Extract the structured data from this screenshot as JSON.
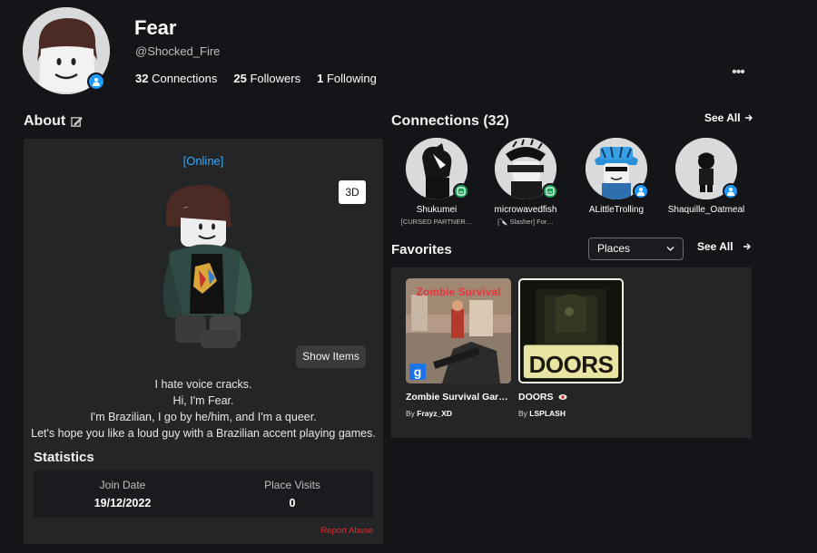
{
  "profile": {
    "display_name": "Fear",
    "username": "@Shocked_Fire",
    "connections_count": "32",
    "connections_label": "Connections",
    "followers_count": "25",
    "followers_label": "Followers",
    "following_count": "1",
    "following_label": "Following",
    "more_label": "•••"
  },
  "about": {
    "title": "About",
    "status": "[Online]",
    "view_3d_label": "3D",
    "show_items_label": "Show Items",
    "bio_lines": [
      "I hate voice cracks.",
      "Hi, I'm Fear.",
      "I'm Brazilian, I go by he/him, and I'm a queer.",
      "Let's hope you like a loud guy with a Brazilian accent playing games."
    ]
  },
  "statistics": {
    "title": "Statistics",
    "join_date_label": "Join Date",
    "join_date_value": "19/12/2022",
    "place_visits_label": "Place Visits",
    "place_visits_value": "0",
    "report_label": "Report Abuse"
  },
  "connections": {
    "title": "Connections (32)",
    "see_all_label": "See All",
    "items": [
      {
        "name": "Shukumei",
        "sub": "[CURSED PARTNER…",
        "presence": "in-game"
      },
      {
        "name": "microwavedfish",
        "sub": "[🔪 Slasher] For…",
        "presence": "in-game"
      },
      {
        "name": "ALittleTrolling",
        "sub": "",
        "presence": "online"
      },
      {
        "name": "Shaquille_Oatmeal",
        "sub": "",
        "presence": "online"
      }
    ]
  },
  "favorites": {
    "title": "Favorites",
    "filter_selected": "Places",
    "see_all_label": "See All",
    "games": [
      {
        "name": "Zombie Survival Garr…",
        "by_label": "By",
        "creator": "Frayz_XD",
        "thumb_title": "Zombie Survival"
      },
      {
        "name": "DOORS",
        "by_label": "By",
        "creator": "LSPLASH",
        "thumb_title": "DOORS"
      }
    ]
  },
  "colors": {
    "background": "#141518",
    "panel": "#232527",
    "accent_blue": "#1e9bff",
    "online_text": "#33a9ff",
    "in_game_green": "#1ea05a",
    "report_red": "#e0302f"
  }
}
